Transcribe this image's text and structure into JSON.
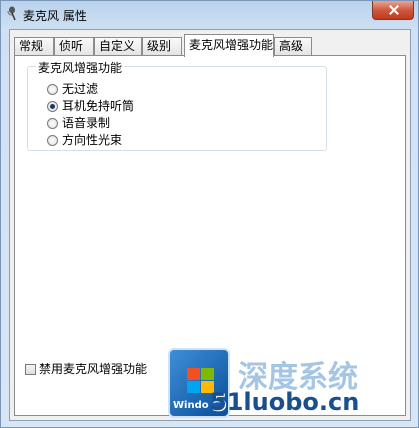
{
  "window": {
    "title": "麦克风 属性"
  },
  "tabs": [
    {
      "label": "常规"
    },
    {
      "label": "侦听"
    },
    {
      "label": "自定义"
    },
    {
      "label": "级别"
    },
    {
      "label": "麦克风增强功能"
    },
    {
      "label": "高级"
    }
  ],
  "group": {
    "label": "麦克风增强功能",
    "options": [
      {
        "label": "无过滤",
        "checked": false
      },
      {
        "label": "耳机免持听筒",
        "checked": true
      },
      {
        "label": "语音录制",
        "checked": false
      },
      {
        "label": "方向性光束",
        "checked": false
      }
    ]
  },
  "disable_checkbox": {
    "label": "禁用麦克风增强功能",
    "checked": false
  },
  "watermark": {
    "text": "51luobo.cn",
    "faded_text": "深度系统",
    "logo_text": "Windo"
  }
}
